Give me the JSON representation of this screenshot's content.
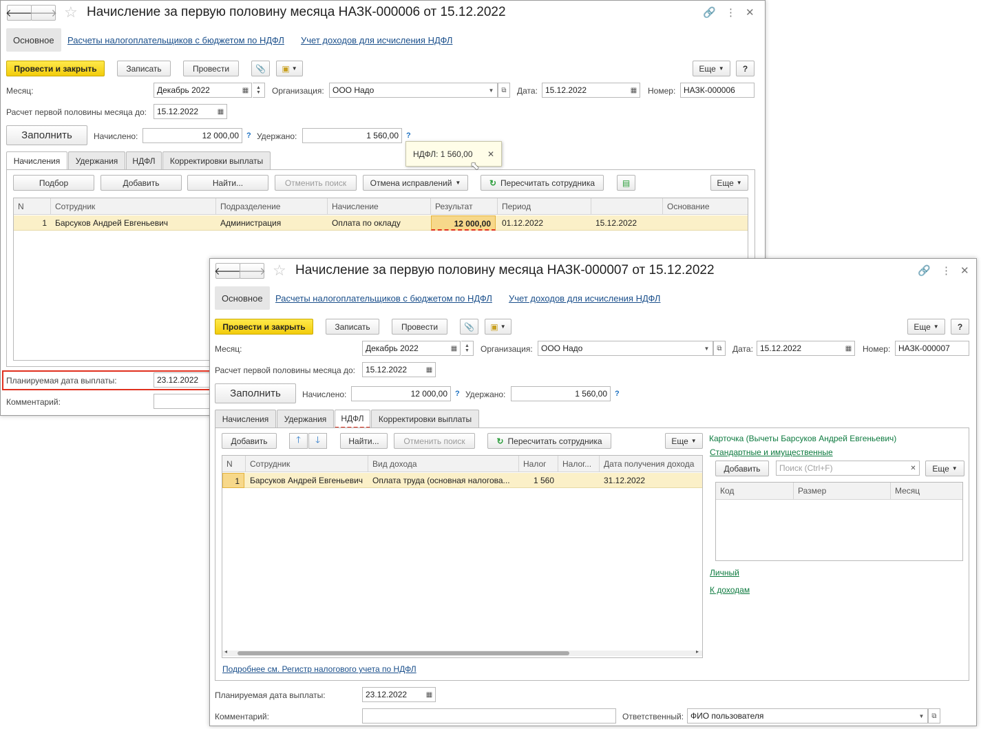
{
  "nav": {
    "back_icon": "arrow-left-icon",
    "forward_icon": "arrow-right-icon",
    "star_glyph": "☆"
  },
  "titlebar_icons": {
    "link": "🔗",
    "more": "⋮",
    "close": "✕"
  },
  "window1": {
    "title": "Начисление за первую половину месяца НАЗК-000006 от 15.12.2022",
    "nav_tabs": [
      "Основное",
      "Расчеты налогоплательщиков с бюджетом по НДФЛ",
      "Учет доходов для исчисления НДФЛ"
    ],
    "toolbar": {
      "post_close": "Провести и закрыть",
      "save": "Записать",
      "post": "Провести",
      "more": "Еще",
      "help": "?"
    },
    "month_label": "Месяц:",
    "month_value": "Декабрь 2022",
    "org_label": "Организация:",
    "org_value": "ООО Надо",
    "date_label": "Дата:",
    "date_value": "15.12.2022",
    "number_label": "Номер:",
    "number_value": "НАЗК-000006",
    "calc_label": "Расчет первой половины месяца до:",
    "calc_value": "15.12.2022",
    "fill_button": "Заполнить",
    "accrued_label": "Начислено:",
    "accrued_value": "12 000,00",
    "withheld_label": "Удержано:",
    "withheld_value": "1 560,00",
    "tooltip": "НДФЛ: 1 560,00",
    "tabs": [
      "Начисления",
      "Удержания",
      "НДФЛ",
      "Корректировки выплаты"
    ],
    "grid_toolbar": {
      "select": "Подбор",
      "add": "Добавить",
      "find": "Найти...",
      "cancel_search": "Отменить поиск",
      "cancel_fix": "Отмена исправлений",
      "recalc": "Пересчитать сотрудника",
      "more": "Еще"
    },
    "columns": [
      "N",
      "Сотрудник",
      "Подразделение",
      "Начисление",
      "Результат",
      "Период",
      "",
      "Основание"
    ],
    "rows": [
      {
        "n": "1",
        "employee": "Барсуков Андрей Евгеньевич",
        "dept": "Администрация",
        "accrual": "Оплата по окладу",
        "result": "12 000,00",
        "period_from": "01.12.2022",
        "period_to": "15.12.2022",
        "basis": ""
      }
    ],
    "pay_date_label": "Планируемая дата выплаты:",
    "pay_date_value": "23.12.2022",
    "comment_label": "Комментарий:"
  },
  "window2": {
    "title": "Начисление за первую половину месяца НАЗК-000007 от 15.12.2022",
    "nav_tabs": [
      "Основное",
      "Расчеты налогоплательщиков с бюджетом по НДФЛ",
      "Учет доходов для исчисления НДФЛ"
    ],
    "toolbar": {
      "post_close": "Провести и закрыть",
      "save": "Записать",
      "post": "Провести",
      "more": "Еще",
      "help": "?"
    },
    "month_label": "Месяц:",
    "month_value": "Декабрь 2022",
    "org_label": "Организация:",
    "org_value": "ООО Надо",
    "date_label": "Дата:",
    "date_value": "15.12.2022",
    "number_label": "Номер:",
    "number_value": "НАЗК-000007",
    "calc_label": "Расчет первой половины месяца до:",
    "calc_value": "15.12.2022",
    "fill_button": "Заполнить",
    "accrued_label": "Начислено:",
    "accrued_value": "12 000,00",
    "withheld_label": "Удержано:",
    "withheld_value": "1 560,00",
    "tabs": [
      "Начисления",
      "Удержания",
      "НДФЛ",
      "Корректировки выплаты"
    ],
    "grid_toolbar": {
      "add": "Добавить",
      "find": "Найти...",
      "cancel_search": "Отменить поиск",
      "recalc": "Пересчитать сотрудника",
      "more": "Еще"
    },
    "columns": [
      "N",
      "Сотрудник",
      "Вид дохода",
      "Налог",
      "Налог...",
      "Дата получения дохода"
    ],
    "rows": [
      {
        "n": "1",
        "employee": "Барсуков Андрей Евгеньевич",
        "income_type": "Оплата труда (основная налогова...",
        "tax": "1 560",
        "tax2": "",
        "income_date": "31.12.2022"
      }
    ],
    "register_link": "Подробнее см. Регистр налогового учета по НДФЛ",
    "card": {
      "title": "Карточка (Вычеты Барсуков Андрей Евгеньевич)",
      "standard_link": "Стандартные и имущественные",
      "add": "Добавить",
      "search_placeholder": "Поиск (Ctrl+F)",
      "more": "Еще",
      "columns": [
        "Код",
        "Размер",
        "Месяц"
      ],
      "personal_link": "Личный",
      "income_link": "К доходам"
    },
    "pay_date_label": "Планируемая дата выплаты:",
    "pay_date_value": "23.12.2022",
    "comment_label": "Комментарий:",
    "comment_value": "",
    "responsible_label": "Ответственный:",
    "responsible_value": "ФИО пользователя"
  }
}
